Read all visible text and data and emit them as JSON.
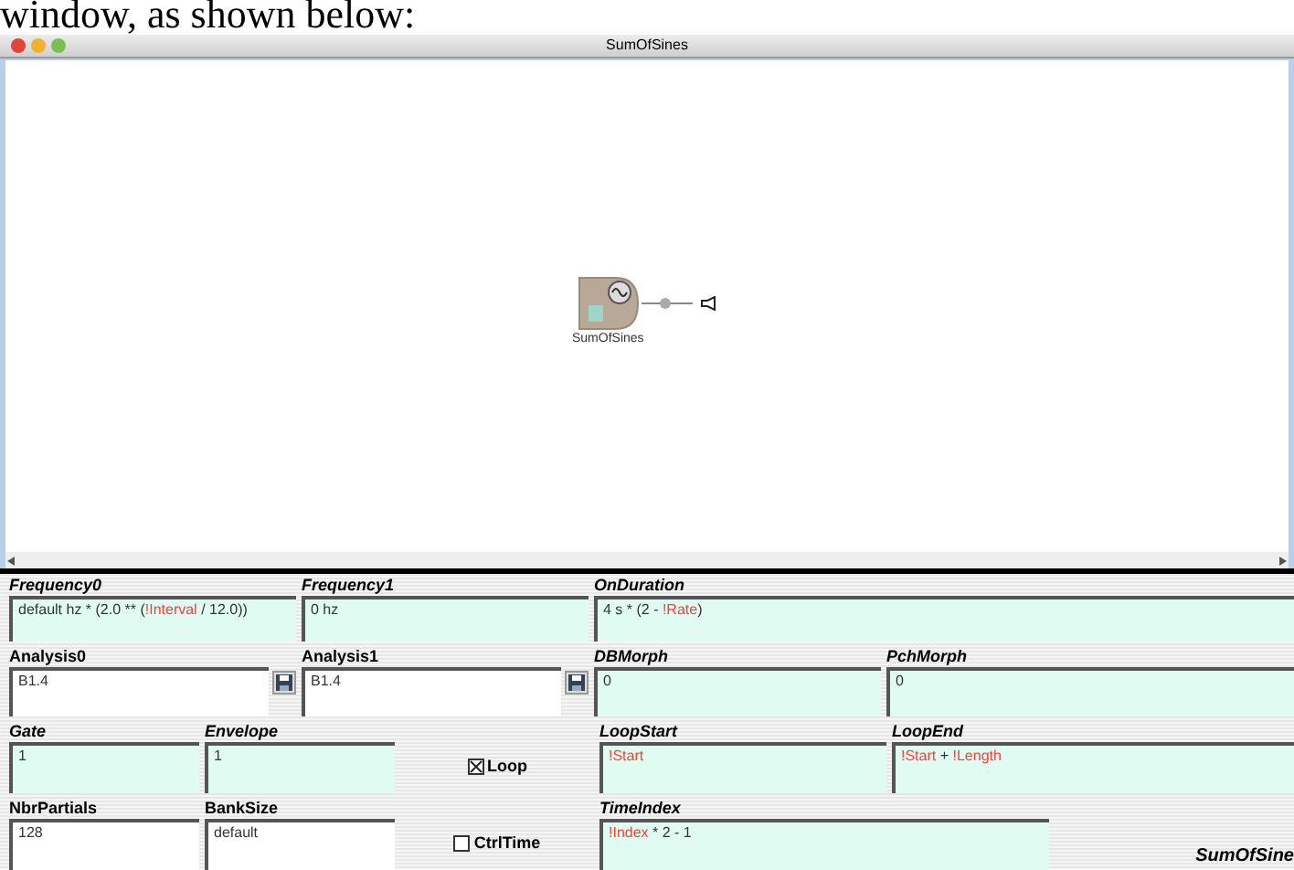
{
  "doc_text": "window, as shown below:",
  "window": {
    "title": "SumOfSines"
  },
  "node": {
    "label": "SumOfSines"
  },
  "rows": [
    [
      {
        "kind": "field",
        "label": "Frequency0",
        "hot": true,
        "value": [
          {
            "text": "default hz * (2.0 ** (",
            "variable": false
          },
          {
            "text": "!Interval",
            "variable": true
          },
          {
            "text": " / 12.0))",
            "variable": false
          }
        ]
      },
      {
        "kind": "field",
        "label": "Frequency1",
        "hot": true,
        "value": [
          {
            "text": "0 hz",
            "variable": false
          }
        ]
      },
      {
        "kind": "field",
        "label": "OnDuration",
        "hot": true,
        "value": [
          {
            "text": "4 s * (2 - ",
            "variable": false
          },
          {
            "text": "!Rate",
            "variable": true
          },
          {
            "text": ")",
            "variable": false
          }
        ]
      }
    ],
    [
      {
        "kind": "field",
        "label": "Analysis0",
        "hot": false,
        "save": true,
        "value": [
          {
            "text": "B1.4",
            "variable": false
          }
        ]
      },
      {
        "kind": "field",
        "label": "Analysis1",
        "hot": false,
        "save": true,
        "value": [
          {
            "text": "B1.4",
            "variable": false
          }
        ]
      },
      {
        "kind": "field",
        "label": "DBMorph",
        "hot": true,
        "value": [
          {
            "text": "0",
            "variable": false
          }
        ]
      },
      {
        "kind": "field",
        "label": "PchMorph",
        "hot": true,
        "value": [
          {
            "text": "0",
            "variable": false
          }
        ]
      }
    ],
    [
      {
        "kind": "field",
        "label": "Gate",
        "hot": true,
        "value": [
          {
            "text": "1",
            "variable": false
          }
        ]
      },
      {
        "kind": "field",
        "label": "Envelope",
        "hot": true,
        "value": [
          {
            "text": "1",
            "variable": false
          }
        ]
      },
      {
        "kind": "checkbox",
        "label": "Loop",
        "checked": true
      },
      {
        "kind": "field",
        "label": "LoopStart",
        "hot": true,
        "value": [
          {
            "text": "!Start",
            "variable": true
          }
        ]
      },
      {
        "kind": "field",
        "label": "LoopEnd",
        "hot": true,
        "value": [
          {
            "text": "!Start",
            "variable": true
          },
          {
            "text": " + ",
            "variable": false
          },
          {
            "text": "!Length",
            "variable": true
          }
        ]
      }
    ],
    [
      {
        "kind": "field",
        "label": "NbrPartials",
        "hot": false,
        "value": [
          {
            "text": "128",
            "variable": false
          }
        ]
      },
      {
        "kind": "field",
        "label": "BankSize",
        "hot": false,
        "value": [
          {
            "text": "default",
            "variable": false
          }
        ]
      },
      {
        "kind": "checkbox",
        "label": "CtrlTime",
        "checked": false
      },
      {
        "kind": "field",
        "label": "TimeIndex",
        "hot": true,
        "value": [
          {
            "text": "!Index",
            "variable": true
          },
          {
            "text": " * 2 - 1",
            "variable": false
          }
        ]
      },
      {
        "kind": "caption",
        "label": "SumOfSine"
      }
    ]
  ]
}
